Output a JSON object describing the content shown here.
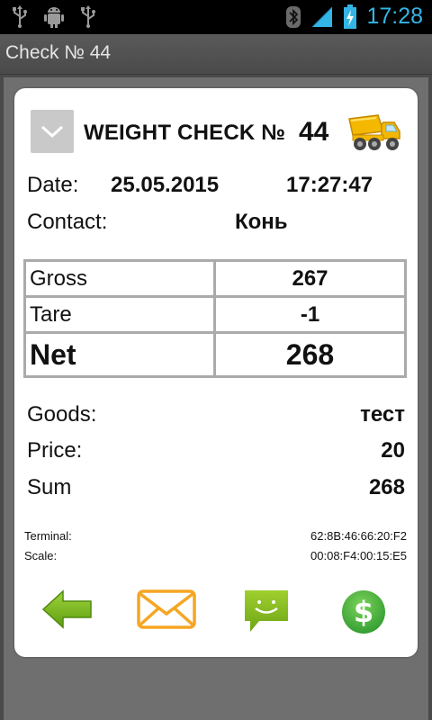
{
  "status_bar": {
    "time": "17:28",
    "icons": [
      "usb-icon",
      "android-debug-icon",
      "usb-icon",
      "bluetooth-icon",
      "signal-icon",
      "battery-charging-icon"
    ]
  },
  "title_bar": {
    "title": "Check № 44"
  },
  "check": {
    "title": "WEIGHT CHECK №",
    "number": "44",
    "date_label": "Date:",
    "date": "25.05.2015",
    "time": "17:27:47",
    "contact_label": "Contact:",
    "contact": "Конь"
  },
  "weights": {
    "gross_label": "Gross",
    "gross": "267",
    "tare_label": "Tare",
    "tare": "-1",
    "net_label": "Net",
    "net": "268"
  },
  "summary": {
    "goods_label": "Goods:",
    "goods": "тест",
    "price_label": "Price:",
    "price": "20",
    "sum_label": "Sum",
    "sum": "268"
  },
  "device": {
    "terminal_label": "Terminal:",
    "terminal": "62:8B:46:66:20:F2",
    "scale_label": "Scale:",
    "scale": "00:08:F4:00:15:E5"
  },
  "actions": [
    "back-arrow-icon",
    "email-icon",
    "sms-icon",
    "dollar-icon"
  ],
  "colors": {
    "status_time": "#33b5e5",
    "green": "#7ab317",
    "orange": "#f5a623",
    "dollar_green": "#4caf50"
  }
}
